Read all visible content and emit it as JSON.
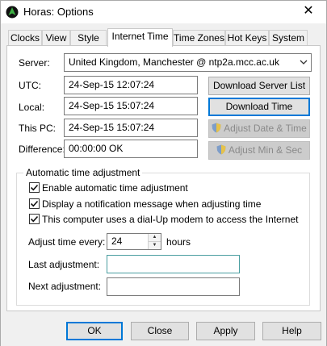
{
  "window": {
    "title": "Horas: Options",
    "close_glyph": "✕"
  },
  "tabs": [
    {
      "label": "Clocks"
    },
    {
      "label": "View"
    },
    {
      "label": "Style"
    },
    {
      "label": "Internet Time",
      "active": true
    },
    {
      "label": "Time Zones"
    },
    {
      "label": "Hot Keys"
    },
    {
      "label": "System"
    }
  ],
  "internet_time": {
    "server_label": "Server:",
    "server_value": "United Kingdom, Manchester @ ntp2a.mcc.ac.uk",
    "utc_label": "UTC:",
    "utc_value": "24-Sep-15 12:07:24",
    "local_label": "Local:",
    "local_value": "24-Sep-15 15:07:24",
    "thispc_label": "This PC:",
    "thispc_value": "24-Sep-15 15:07:24",
    "difference_label": "Difference:",
    "difference_value": "00:00:00 OK",
    "download_server_list": "Download Server List",
    "download_time": "Download Time",
    "adjust_date_time": "Adjust Date & Time",
    "adjust_min_sec": "Adjust Min & Sec"
  },
  "auto_adjust": {
    "group_title": "Automatic time adjustment",
    "enable_label": "Enable automatic time adjustment",
    "enable_checked": true,
    "notify_label": "Display a notification message when adjusting time",
    "notify_checked": true,
    "dialup_label": "This computer uses a dial-Up modem to access the Internet",
    "dialup_checked": true,
    "adjust_every_label": "Adjust time every:",
    "adjust_every_value": "24",
    "adjust_every_unit": "hours",
    "last_adjustment_label": "Last adjustment:",
    "last_adjustment_value": "",
    "next_adjustment_label": "Next adjustment:",
    "next_adjustment_value": ""
  },
  "buttons": {
    "ok": "OK",
    "close": "Close",
    "apply": "Apply",
    "help": "Help"
  },
  "colors": {
    "focus_border": "#0078d7",
    "button_face": "#e1e1e1",
    "dialog_bg": "#f0f0f0"
  }
}
